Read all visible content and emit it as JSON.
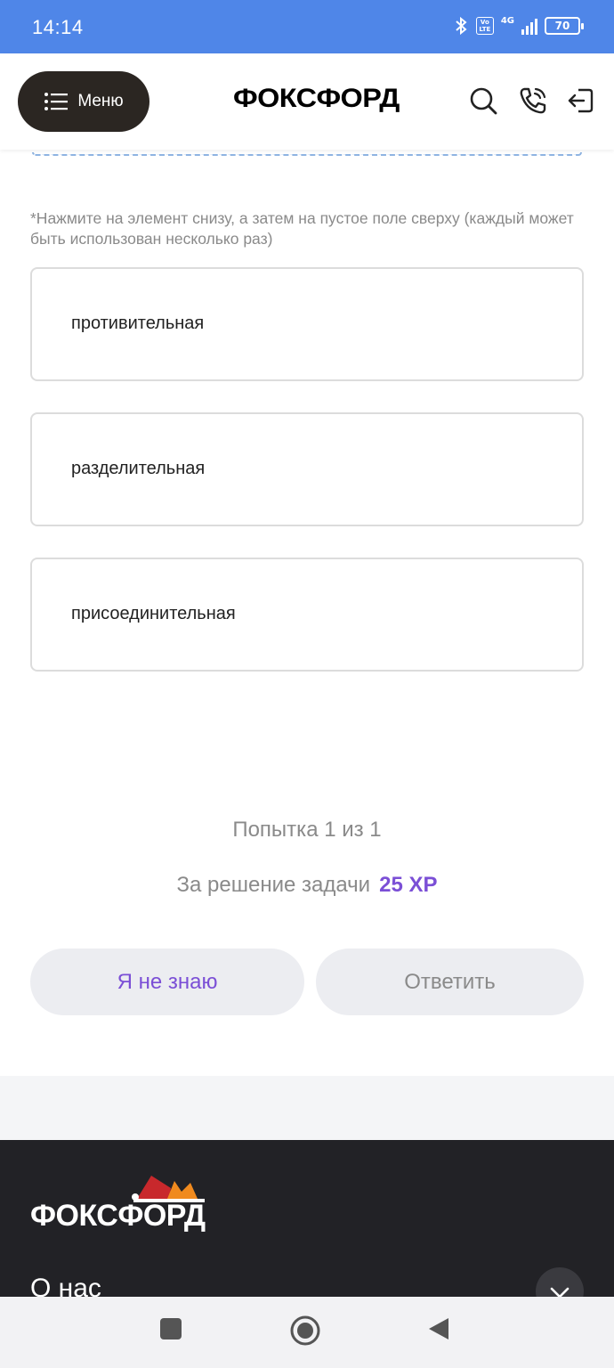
{
  "status_bar": {
    "time": "14:14",
    "volte": "Vo LTE",
    "network": "4G",
    "battery": "70"
  },
  "header": {
    "menu_label": "Меню",
    "logo": "ФОКСФОРД",
    "icons": [
      "search-icon",
      "phone-icon",
      "logout-icon"
    ]
  },
  "task": {
    "hint": "*Нажмите на элемент снизу, а затем на пустое поле сверху (каждый может быть использован несколько раз)",
    "options": [
      "противительная",
      "разделительная",
      "присоединительная"
    ],
    "attempt": "Попытка 1 из 1",
    "reward_label": "За решение задачи",
    "reward_xp": "25 XP",
    "dont_know_label": "Я не знаю",
    "answer_label": "Ответить"
  },
  "footer": {
    "logo": "ФОКСФОРД",
    "about": "О нас"
  },
  "colors": {
    "status_bar": "#4f86e8",
    "accent_purple": "#7b4fd6",
    "menu_button": "#2b2622",
    "footer_bg": "#222226"
  }
}
